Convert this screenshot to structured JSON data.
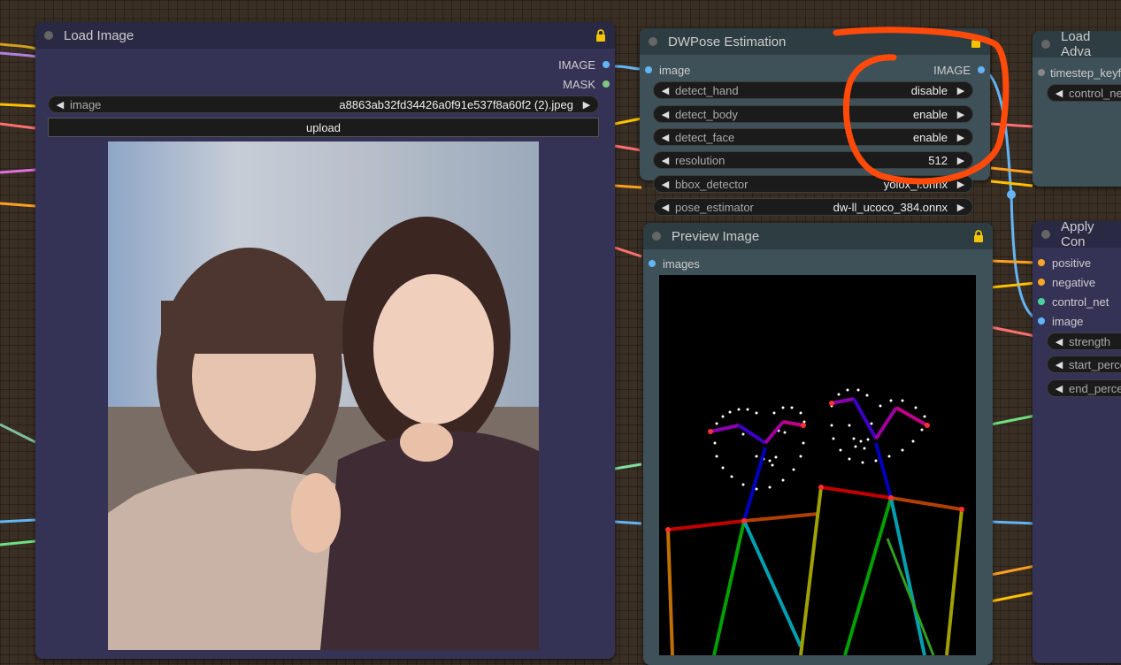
{
  "load_image": {
    "title": "Load Image",
    "out_image": "IMAGE",
    "out_mask": "MASK",
    "image_label": "image",
    "image_value": "a8863ab32fd34426a0f91e537f8a60f2 (2).jpeg",
    "upload_label": "upload"
  },
  "dwpose": {
    "title": "DWPose Estimation",
    "in_image": "image",
    "out_image": "IMAGE",
    "widgets": [
      {
        "label": "detect_hand",
        "value": "disable"
      },
      {
        "label": "detect_body",
        "value": "enable"
      },
      {
        "label": "detect_face",
        "value": "enable"
      },
      {
        "label": "resolution",
        "value": "512"
      },
      {
        "label": "bbox_detector",
        "value": "yolox_l.onnx"
      },
      {
        "label": "pose_estimator",
        "value": "dw-ll_ucoco_384.onnx"
      }
    ]
  },
  "preview": {
    "title": "Preview Image",
    "in_images": "images"
  },
  "load_adv": {
    "title": "Load Adva",
    "in_timestep": "timestep_keyf",
    "widget_control": "control_ne"
  },
  "apply": {
    "title": "Apply Con",
    "inputs": [
      "positive",
      "negative",
      "control_net",
      "image"
    ],
    "widgets": [
      "strength",
      "start_perce",
      "end_perce"
    ]
  },
  "colors": {
    "node_body_load": "#353355",
    "node_header_load": "#2a2944",
    "node_body_dw": "#335",
    "port_image": "#64b5f6",
    "port_mask": "#81c784",
    "port_cond": "#ffa726",
    "annotation": "#ff4a0a"
  }
}
